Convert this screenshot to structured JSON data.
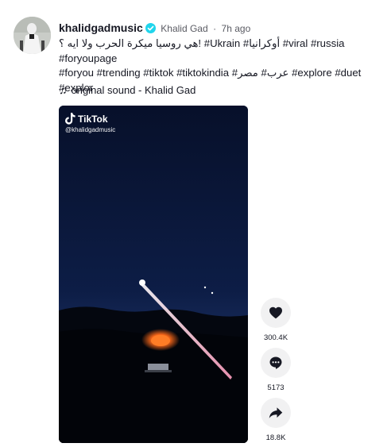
{
  "post": {
    "username": "khalidgadmusic",
    "nickname": "Khalid Gad",
    "separator": "·",
    "time_ago": "7h ago",
    "caption_line1_arabic": "هي روسيا ميكرة الحرب ولا ايه ؟",
    "caption_line1_rest": "! #Ukrain #أوكرانيا #viral #russia #foryoupage",
    "caption_line2": "#foryou #trending #tiktok #tiktokindia #عرب# مصر #explore #duet",
    "caption_line3": "#explor",
    "sound": "original sound - Khalid Gad"
  },
  "video": {
    "watermark_title": "TikTok",
    "watermark_handle": "@khalidgadmusic"
  },
  "actions": {
    "likes": "300.4K",
    "comments": "5173",
    "shares": "18.8K"
  },
  "icons": {
    "verified": "verified-badge-icon",
    "music": "music-note-icon",
    "like": "heart-icon",
    "comment": "comment-bubble-icon",
    "share": "share-arrow-icon",
    "tiktok": "tiktok-logo-icon"
  },
  "colors": {
    "verified": "#20d5ec",
    "video_bg": "#0a1530",
    "fire": "#ff6a1a",
    "action_circle": "#f1f1f2"
  }
}
